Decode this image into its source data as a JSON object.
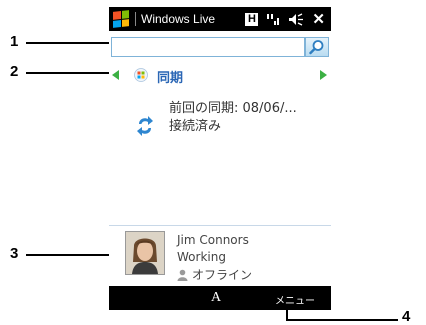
{
  "titlebar": {
    "app_title": "Windows Live",
    "h_icon": "H"
  },
  "search": {
    "value": "",
    "icon": "search-icon"
  },
  "nav": {
    "title": "同期"
  },
  "sync": {
    "line1": "前回の同期: 08/06/...",
    "line2": "接続済み"
  },
  "contact": {
    "name": "Jim Connors",
    "status": "Working",
    "presence": "オフライン"
  },
  "softkeys": {
    "left": "A",
    "right": "メニュー"
  },
  "callouts": {
    "c1": "1",
    "c2": "2",
    "c3": "3",
    "c4": "4"
  },
  "colors": {
    "accent_blue": "#2a66b5",
    "arrow_green": "#3cb043",
    "bar_black": "#000000"
  }
}
